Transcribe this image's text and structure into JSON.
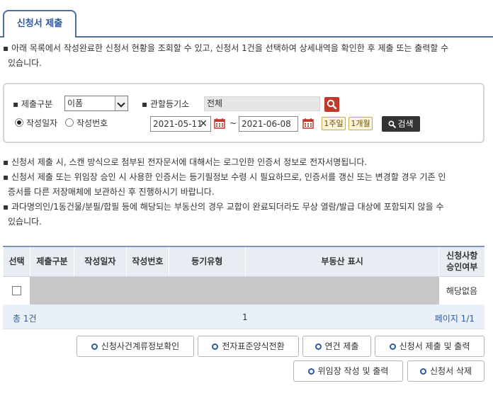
{
  "tab": {
    "label": "신청서 제출"
  },
  "intro": {
    "line1": "▪ 아래 목록에서 작성완료한 신청서 현황을 조회할 수 있고, 신청서 1건을 선택하여 상세내역을 확인한 후 제출 또는 출력할 수",
    "line2": "있습니다."
  },
  "search": {
    "type_label": "▪ 제출구분",
    "type_value": "이폼",
    "office_label": "▪ 관할등기소",
    "office_value": "전체",
    "radio_date_label": "작성일자",
    "radio_no_label": "작성번호",
    "date_from": "2021-05-11",
    "clear_glyph": "✕",
    "tilde": "~",
    "date_to": "2021-06-08",
    "week_btn": "1주일",
    "month_btn": "1개월",
    "search_btn": "검색"
  },
  "notices": [
    "▪ 신청서 제출 시, 스캔 방식으로 첨부된 전자문서에 대해서는 로그인한 인증서 정보로 전자서명됩니다.",
    "▪ 신청서 제출 또는 위임장 승인 시 사용한 인증서는 등기필정보 수령 시 필요하므로, 인증서를 갱신 또는 변경할 경우 기존 인",
    "증서를 다른 저장매체에 보관하신 후 진행하시기 바랍니다.",
    "▪ 과다명의인/1동건물/분필/합필 등에 해당되는 부동산의 경우 교합이 완료되더라도 무상 열람/발급 대상에 포함되지 않을 수",
    "있습니다."
  ],
  "table": {
    "headers": [
      "선택",
      "제출구분",
      "작성일자",
      "작성번호",
      "등기유형",
      "부동산 표시",
      "신청사항\n승인여부"
    ],
    "header_last_line1": "신청사항",
    "header_last_line2": "승인여부",
    "rows": [
      {
        "status": "해당없음"
      }
    ]
  },
  "pager": {
    "total": "총 1건",
    "page_numbers": "1",
    "page_info": "페이지 1/1"
  },
  "actions": [
    "신청사건계류정보확인",
    "전자표준양식전환",
    "연건 제출",
    "신청서 제출 및 출력",
    "위임장 작성 및 출력",
    "신청서 삭제"
  ],
  "colors": {
    "accent": "#2b5aa0",
    "search_red": "#c0392b"
  }
}
